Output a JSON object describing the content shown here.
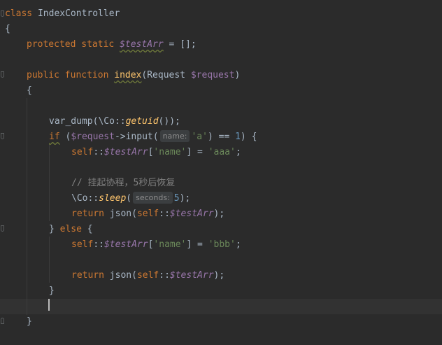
{
  "code": {
    "l1": {
      "kw": "class",
      "name": "IndexController"
    },
    "l2": {
      "brace": "{"
    },
    "l3": {
      "kw1": "protected",
      "kw2": "static",
      "var": "$testArr",
      "rest": " = [];"
    },
    "l5": {
      "kw1": "public",
      "kw2": "function",
      "fn": "index",
      "p1": "(Request ",
      "var": "$request",
      "p2": ")"
    },
    "l6": {
      "brace": "{"
    },
    "l8": {
      "a": "var_dump(\\Co::",
      "fn": "getuid",
      "b": "());"
    },
    "l9": {
      "kw": "if",
      "a": " (",
      "var": "$request",
      "b": "->input(",
      "hint": "name:",
      "str": "'a'",
      "c": ") == ",
      "num": "1",
      "d": ") {"
    },
    "l10": {
      "kw": "self",
      "a": "::",
      "var": "$testArr",
      "b": "[",
      "str1": "'name'",
      "c": "] = ",
      "str2": "'aaa'",
      "d": ";"
    },
    "l12": {
      "comment": "// 挂起协程，5秒后恢复"
    },
    "l13": {
      "a": "\\Co::",
      "fn": "sleep",
      "b": "(",
      "hint": "seconds:",
      "num": "5",
      "c": ");"
    },
    "l14": {
      "kw": "return",
      "a": " json(",
      "kw2": "self",
      "b": "::",
      "var": "$testArr",
      "c": ");"
    },
    "l15": {
      "a": "} ",
      "kw": "else",
      "b": " {"
    },
    "l16": {
      "kw": "self",
      "a": "::",
      "var": "$testArr",
      "b": "[",
      "str1": "'name'",
      "c": "] = ",
      "str2": "'bbb'",
      "d": ";"
    },
    "l18": {
      "kw": "return",
      "a": " json(",
      "kw2": "self",
      "b": "::",
      "var": "$testArr",
      "c": ");"
    },
    "l19": {
      "brace": "}"
    },
    "l21": {
      "brace": "}"
    }
  },
  "colors": {
    "background": "#2b2b2b",
    "keyword": "#cc7832",
    "function": "#ffc66d",
    "variable": "#9876aa",
    "string": "#6a8759",
    "number": "#6897bb",
    "comment": "#808080",
    "text": "#a9b7c6",
    "current_line": "#323232"
  }
}
